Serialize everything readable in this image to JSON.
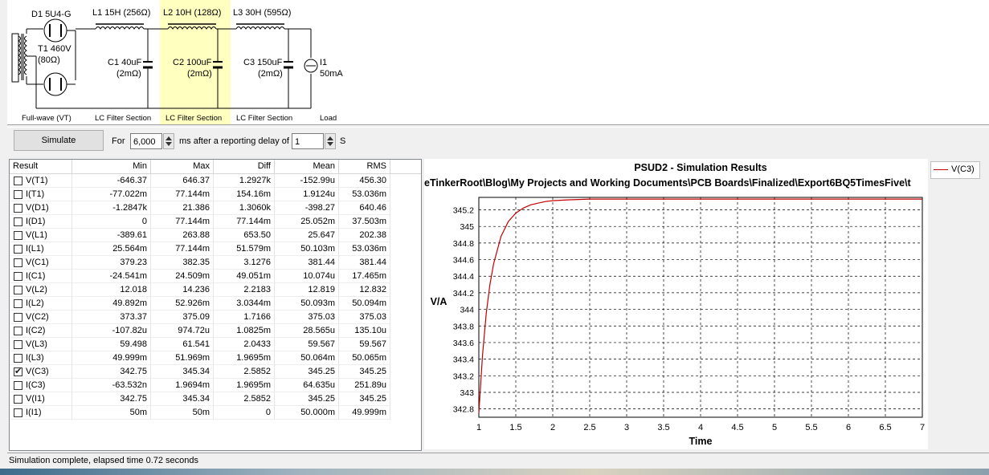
{
  "schematic": {
    "d1": "D1 5U4-G",
    "t1_line1": "T1 460V",
    "t1_line2": "(80Ω)",
    "l1": "L1 15H (256Ω)",
    "l2": "L2 10H (128Ω)",
    "l3": "L3 30H (595Ω)",
    "c1_line1": "C1 40uF",
    "c1_line2": "(2mΩ)",
    "c2_line1": "C2 100uF",
    "c2_line2": "(2mΩ)",
    "c3_line1": "C3 150uF",
    "c3_line2": "(2mΩ)",
    "i1_line1": "I1",
    "i1_line2": "50mA",
    "stage_fullwave": "Full-wave (VT)",
    "stage_lc1": "LC Filter Section",
    "stage_lc2": "LC Filter Section",
    "stage_lc3": "LC Filter Section",
    "stage_load": "Load"
  },
  "toolbar": {
    "simulate": "Simulate",
    "for_label": "For",
    "duration": "6,000",
    "ms_label": "ms  after a reporting delay of",
    "delay": "1",
    "s_label": "S"
  },
  "table": {
    "headers": [
      "Result",
      "Min",
      "Max",
      "Diff",
      "Mean",
      "RMS"
    ],
    "rows": [
      {
        "name": "V(T1)",
        "min": "-646.37",
        "max": "646.37",
        "diff": "1.2927k",
        "mean": "-152.99u",
        "rms": "456.30",
        "checked": false
      },
      {
        "name": "I(T1)",
        "min": "-77.022m",
        "max": "77.144m",
        "diff": "154.16m",
        "mean": "1.9124u",
        "rms": "53.036m",
        "checked": false
      },
      {
        "name": "V(D1)",
        "min": "-1.2847k",
        "max": "21.386",
        "diff": "1.3060k",
        "mean": "-398.27",
        "rms": "640.46",
        "checked": false
      },
      {
        "name": "I(D1)",
        "min": "0",
        "max": "77.144m",
        "diff": "77.144m",
        "mean": "25.052m",
        "rms": "37.503m",
        "checked": false
      },
      {
        "name": "V(L1)",
        "min": "-389.61",
        "max": "263.88",
        "diff": "653.50",
        "mean": "25.647",
        "rms": "202.38",
        "checked": false
      },
      {
        "name": "I(L1)",
        "min": "25.564m",
        "max": "77.144m",
        "diff": "51.579m",
        "mean": "50.103m",
        "rms": "53.036m",
        "checked": false
      },
      {
        "name": "V(C1)",
        "min": "379.23",
        "max": "382.35",
        "diff": "3.1276",
        "mean": "381.44",
        "rms": "381.44",
        "checked": false
      },
      {
        "name": "I(C1)",
        "min": "-24.541m",
        "max": "24.509m",
        "diff": "49.051m",
        "mean": "10.074u",
        "rms": "17.465m",
        "checked": false
      },
      {
        "name": "V(L2)",
        "min": "12.018",
        "max": "14.236",
        "diff": "2.2183",
        "mean": "12.819",
        "rms": "12.832",
        "checked": false
      },
      {
        "name": "I(L2)",
        "min": "49.892m",
        "max": "52.926m",
        "diff": "3.0344m",
        "mean": "50.093m",
        "rms": "50.094m",
        "checked": false
      },
      {
        "name": "V(C2)",
        "min": "373.37",
        "max": "375.09",
        "diff": "1.7166",
        "mean": "375.03",
        "rms": "375.03",
        "checked": false
      },
      {
        "name": "I(C2)",
        "min": "-107.82u",
        "max": "974.72u",
        "diff": "1.0825m",
        "mean": "28.565u",
        "rms": "135.10u",
        "checked": false
      },
      {
        "name": "V(L3)",
        "min": "59.498",
        "max": "61.541",
        "diff": "2.0433",
        "mean": "59.567",
        "rms": "59.567",
        "checked": false
      },
      {
        "name": "I(L3)",
        "min": "49.999m",
        "max": "51.969m",
        "diff": "1.9695m",
        "mean": "50.064m",
        "rms": "50.065m",
        "checked": false
      },
      {
        "name": "V(C3)",
        "min": "342.75",
        "max": "345.34",
        "diff": "2.5852",
        "mean": "345.25",
        "rms": "345.25",
        "checked": true
      },
      {
        "name": "I(C3)",
        "min": "-63.532n",
        "max": "1.9694m",
        "diff": "1.9695m",
        "mean": "64.635u",
        "rms": "251.89u",
        "checked": false
      },
      {
        "name": "V(I1)",
        "min": "342.75",
        "max": "345.34",
        "diff": "2.5852",
        "mean": "345.25",
        "rms": "345.25",
        "checked": false
      },
      {
        "name": "I(I1)",
        "min": "50m",
        "max": "50m",
        "diff": "0",
        "mean": "50.000m",
        "rms": "49.999m",
        "checked": false
      }
    ]
  },
  "chart": {
    "title": "PSUD2 - Simulation Results",
    "path": "eTinkerRoot\\Blog\\My Projects and Working Documents\\PCB Boards\\Finalized\\Export6BQ5TimesFive\\t"
  },
  "chart_data": {
    "type": "line",
    "title": "PSUD2 - Simulation Results",
    "xlabel": "Time",
    "ylabel": "V/A",
    "xlim": [
      1,
      7
    ],
    "ylim": [
      342.7,
      345.35
    ],
    "xticks": [
      "1",
      "1.5",
      "2",
      "2.5",
      "3",
      "3.5",
      "4",
      "4.5",
      "5",
      "5.5",
      "6",
      "6.5",
      "7"
    ],
    "yticks": [
      "342.8",
      "343",
      "343.2",
      "343.4",
      "343.6",
      "343.8",
      "344",
      "344.2",
      "344.4",
      "344.6",
      "344.8",
      "345",
      "345.2"
    ],
    "grid": true,
    "legend_position": "top-right",
    "series": [
      {
        "name": "V(C3)",
        "color": "#c00000",
        "x": [
          1.0,
          1.05,
          1.1,
          1.15,
          1.2,
          1.3,
          1.4,
          1.5,
          1.6,
          1.7,
          1.8,
          1.9,
          2.0,
          2.2,
          2.5,
          3.0,
          4.0,
          5.0,
          6.0,
          7.0
        ],
        "y": [
          342.75,
          343.45,
          343.95,
          344.3,
          344.55,
          344.88,
          345.06,
          345.16,
          345.22,
          345.26,
          345.28,
          345.3,
          345.31,
          345.32,
          345.33,
          345.33,
          345.33,
          345.33,
          345.33,
          345.33
        ]
      }
    ]
  },
  "legend": {
    "label": "V(C3)"
  },
  "status": "Simulation complete, elapsed time 0.72 seconds"
}
